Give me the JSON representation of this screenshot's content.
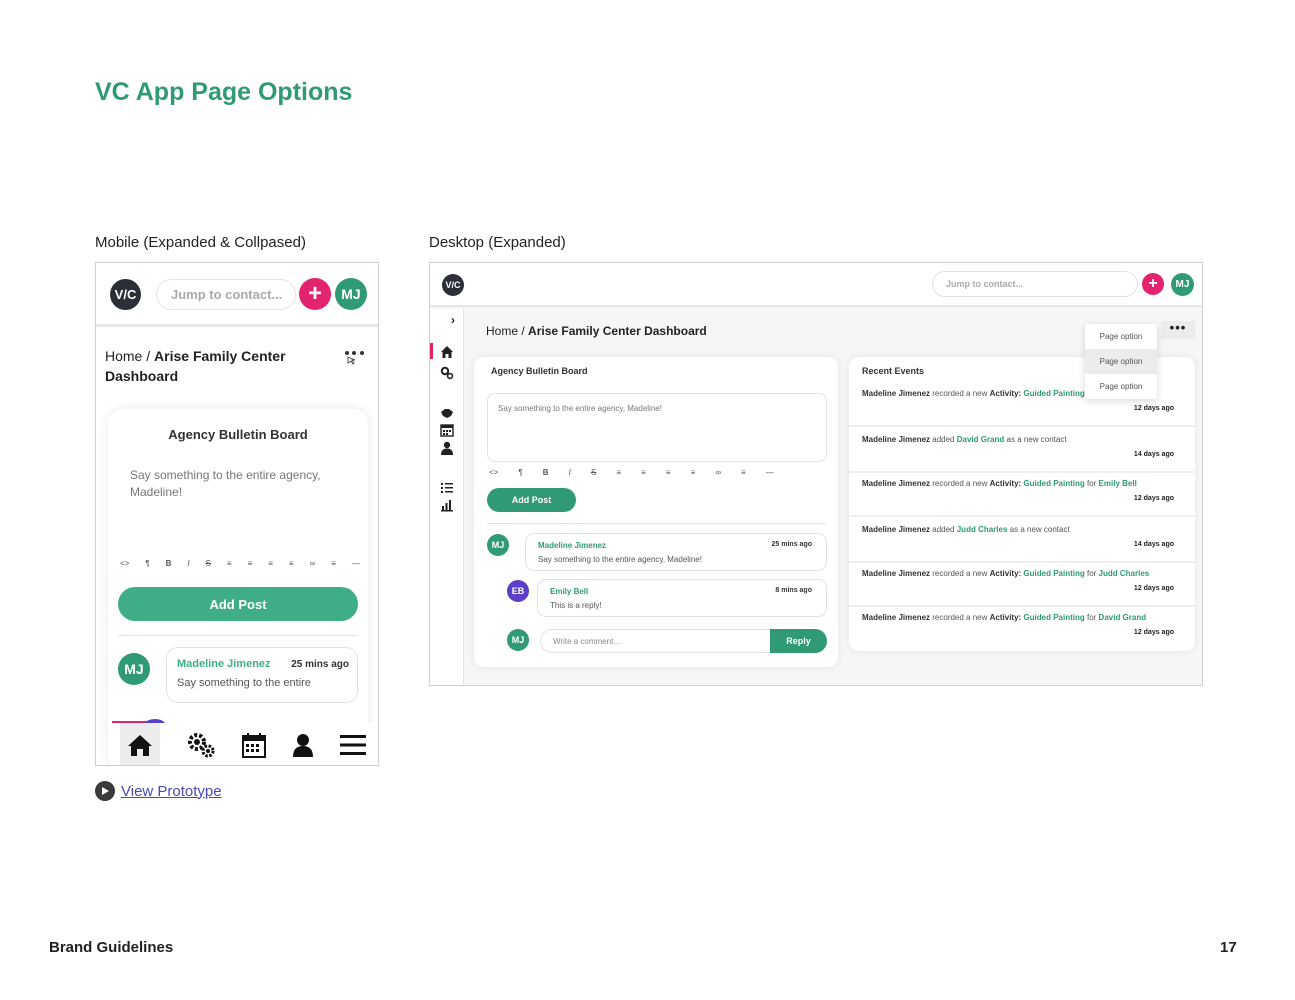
{
  "page_title": "VC App Page Options",
  "labels": {
    "mobile": "Mobile (Expanded & Collpased)",
    "desktop": "Desktop (Expanded)"
  },
  "colors": {
    "brand_green": "#2f9a73",
    "accent_pink": "#e4236f",
    "avatar_purple": "#5b3fc9",
    "logo_dark": "#2b3038"
  },
  "mobile": {
    "logo": "V/C",
    "search_placeholder": "Jump to contact...",
    "plus": "+",
    "user_initials": "MJ",
    "breadcrumb_home": "Home",
    "breadcrumb_sep": " / ",
    "breadcrumb_page": "Arise Family Center Dashboard",
    "more_icon": "more-options-icon",
    "card_title": "Agency Bulletin Board",
    "textarea_text": "Say something to the entire agency, Madeline!",
    "toolbar": [
      "<>",
      "¶",
      "B",
      "I",
      "S",
      "≡",
      "≡",
      "≡",
      "≡",
      "∞",
      "≡",
      "—"
    ],
    "add_post": "Add Post",
    "comment": {
      "initials": "MJ",
      "name": "Madeline Jimenez",
      "time": "25 mins ago",
      "text": "Say something to the entire"
    },
    "bottom_nav": [
      "home-icon",
      "gears-icon",
      "calendar-icon",
      "person-icon",
      "menu-icon"
    ]
  },
  "desktop": {
    "logo": "V/C",
    "search_placeholder": "Jump to contact...",
    "plus": "+",
    "user_initials": "MJ",
    "expand": "›",
    "sidebar_icons": [
      "home-icon",
      "gears-icon",
      "handshake-icon",
      "calendar-icon",
      "person-icon",
      "checklist-icon",
      "chart-icon"
    ],
    "breadcrumb_home": "Home",
    "breadcrumb_sep": " / ",
    "breadcrumb_page": "Arise Family Center Dashboard",
    "dots": "•••",
    "page_options": [
      "Page option",
      "Page option",
      "Page option"
    ],
    "bulletin": {
      "title": "Agency Bulletin Board",
      "textarea_text": "Say something to the entire agency, Madeline!",
      "toolbar": [
        "<>",
        "¶",
        "B",
        "I",
        "S",
        "≡",
        "≡",
        "≡",
        "≡",
        "∞",
        "≡",
        "—"
      ],
      "add_post": "Add Post",
      "comment": {
        "initials": "MJ",
        "name": "Madeline Jimenez",
        "time": "25 mins ago",
        "text": "Say something to the entire agency, Madeline!"
      },
      "reply": {
        "initials": "EB",
        "name": "Emily Bell",
        "time": "8 mins ago",
        "text": "This is a reply!"
      },
      "comment_input": {
        "initials": "MJ",
        "placeholder": "Write a comment…",
        "button": "Reply"
      }
    },
    "events": {
      "title": "Recent Events",
      "items": [
        {
          "actor": "Madeline Jimenez",
          "verb": " recorded a new ",
          "kw": "Activity:",
          "obj": "Guided Painting",
          "prep": "",
          "target": "",
          "ago": "12 days ago"
        },
        {
          "actor": "Madeline Jimenez",
          "verb": " added ",
          "kw": "",
          "obj": "David Grand",
          "prep": " as a new contact",
          "target": "",
          "ago": "14 days ago"
        },
        {
          "actor": "Madeline Jimenez",
          "verb": " recorded a new ",
          "kw": "Activity:",
          "obj": "Guided Painting",
          "prep": " for ",
          "target": "Emily Bell",
          "ago": "12 days ago"
        },
        {
          "actor": "Madeline Jimenez",
          "verb": " added ",
          "kw": "",
          "obj": "Judd Charles",
          "prep": " as a new contact",
          "target": "",
          "ago": "14 days ago"
        },
        {
          "actor": "Madeline Jimenez",
          "verb": " recorded a new ",
          "kw": "Activity:",
          "obj": "Guided Painting",
          "prep": " for ",
          "target": "Judd Charles",
          "ago": "12 days ago"
        },
        {
          "actor": "Madeline Jimenez",
          "verb": " recorded a new ",
          "kw": "Activity:",
          "obj": "Guided Painting",
          "prep": " for ",
          "target": "David Grand",
          "ago": "12 days ago"
        }
      ]
    }
  },
  "view_prototype": "View Prototype",
  "footer": {
    "left": "Brand Guidelines",
    "page_number": "17"
  }
}
